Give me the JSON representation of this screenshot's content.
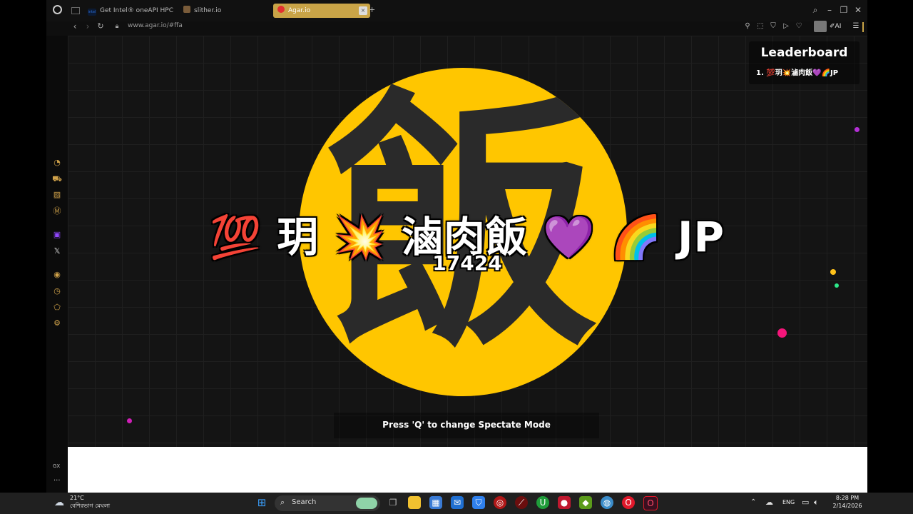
{
  "browser": {
    "tabs": [
      {
        "label": "Get Intel® oneAPI HPC Too",
        "favicon_text": "intel",
        "color": "#2b6cd8"
      },
      {
        "label": "slither.io",
        "favicon_text": "",
        "color": "#7a5c3a"
      },
      {
        "label": "Agar.io",
        "favicon_text": "",
        "color": "#e23030",
        "active": true
      }
    ],
    "new_tab_label": "+",
    "url": "www.agar.io/#ffa",
    "ai_label": "AI",
    "gx_label": "GX",
    "sidebar_more": "...",
    "accent_color": "#c9a447"
  },
  "game": {
    "cell_glyph": "飯",
    "cell_color": "#ffc600",
    "player_name": "💯 玥 💥 滷肉飯 💜 🌈 JP",
    "player_score": "17424",
    "leaderboard": {
      "title": "Leaderboard",
      "entries": [
        "1. 💯玥💥滷肉飯💜🌈JP"
      ]
    },
    "spectate_hint": "Press 'Q' to change Spectate Mode",
    "pellet_colors": [
      "#b42fd6",
      "#ffc21a",
      "#2de88a",
      "#f5157a",
      "#d01fb8"
    ]
  },
  "taskbar": {
    "weather_temp": "21°C",
    "weather_desc": "বেশিরভাগ মেঘলা",
    "search_label": "Search",
    "language": "ENG",
    "time": "8:28 PM",
    "date": "2/14/2026"
  }
}
